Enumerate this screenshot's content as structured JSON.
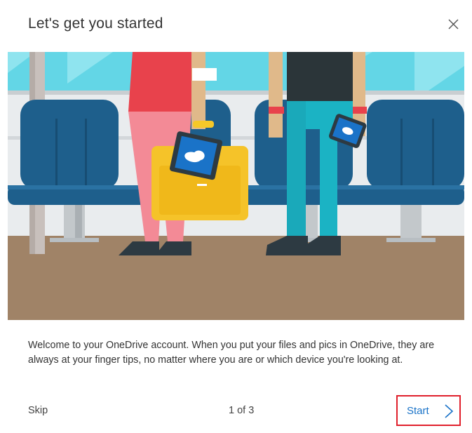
{
  "dialog": {
    "title": "Let's get you started",
    "close_icon": "close-icon",
    "hero_image": "commuters-on-train-illustration",
    "description": "Welcome to your OneDrive account. When you put your files and pics in OneDrive, they are always at your finger tips, no matter where you are or which device you're looking at.",
    "skip_label": "Skip",
    "page_indicator": "1 of 3",
    "start_label": "Start",
    "start_icon": "chevron-right-icon"
  },
  "colors": {
    "accent_link": "#1a73c8",
    "highlight_box": "#e0202c",
    "floor": "#a08367",
    "seat": "#1e5f8c",
    "window": "#63d6e6"
  }
}
